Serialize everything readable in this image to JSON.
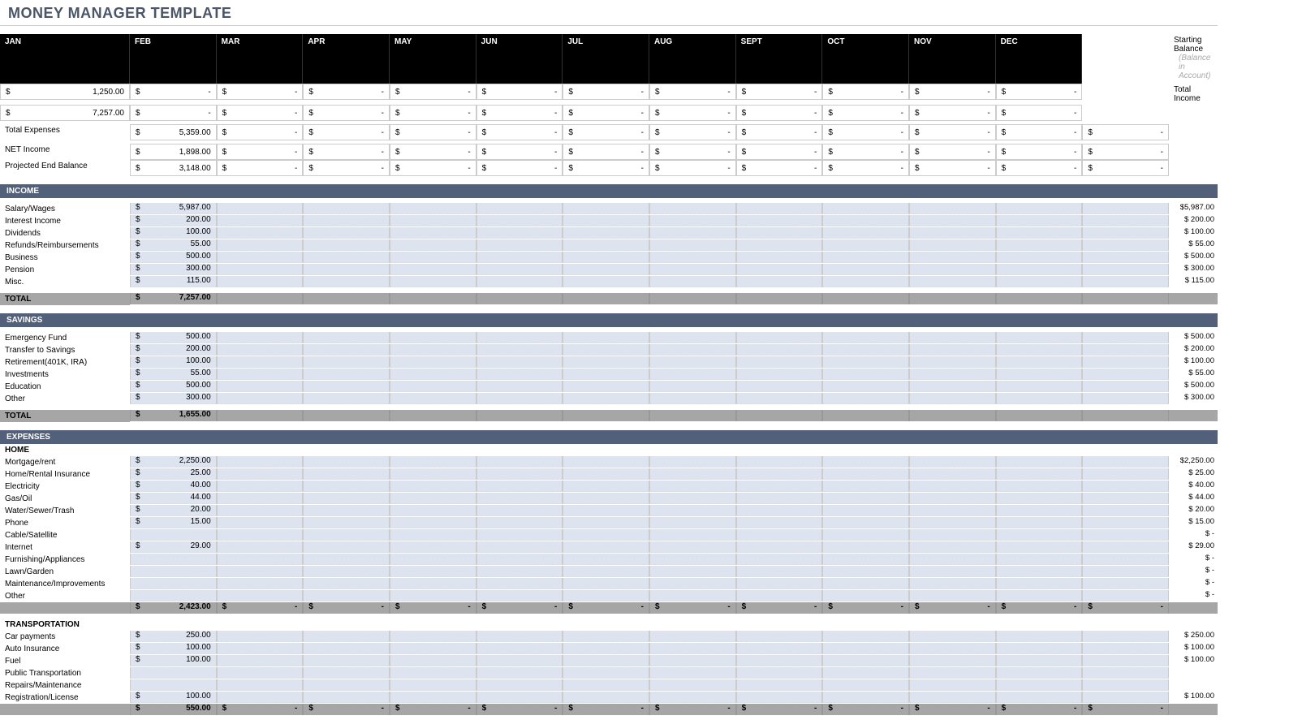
{
  "title": "MONEY MANAGER TEMPLATE",
  "months": [
    "JAN",
    "FEB",
    "MAR",
    "APR",
    "MAY",
    "JUN",
    "JUL",
    "AUG",
    "SEPT",
    "OCT",
    "NOV",
    "DEC"
  ],
  "summary": [
    {
      "label": "Starting Balance",
      "sublabel": "(Balance in Account)",
      "values": [
        "1,250.00",
        "-",
        "-",
        "-",
        "-",
        "-",
        "-",
        "-",
        "-",
        "-",
        "-",
        "-"
      ]
    },
    {
      "label": "Total Income",
      "values": [
        "7,257.00",
        "-",
        "-",
        "-",
        "-",
        "-",
        "-",
        "-",
        "-",
        "-",
        "-",
        "-"
      ]
    },
    {
      "label": "Total Expenses",
      "values": [
        "5,359.00",
        "-",
        "-",
        "-",
        "-",
        "-",
        "-",
        "-",
        "-",
        "-",
        "-",
        "-"
      ]
    },
    {
      "label": "NET Income",
      "values": [
        "1,898.00",
        "-",
        "-",
        "-",
        "-",
        "-",
        "-",
        "-",
        "-",
        "-",
        "-",
        "-"
      ]
    },
    {
      "label": "Projected End Balance",
      "values": [
        "3,148.00",
        "-",
        "-",
        "-",
        "-",
        "-",
        "-",
        "-",
        "-",
        "-",
        "-",
        "-"
      ]
    }
  ],
  "sections": [
    {
      "name": "INCOME",
      "rows": [
        {
          "label": "Salary/Wages",
          "jan": "5,987.00",
          "total": "$5,987.00"
        },
        {
          "label": "Interest Income",
          "jan": "200.00",
          "total": "$  200.00"
        },
        {
          "label": "Dividends",
          "jan": "100.00",
          "total": "$  100.00"
        },
        {
          "label": "Refunds/Reimbursements",
          "jan": "55.00",
          "total": "$    55.00"
        },
        {
          "label": "Business",
          "jan": "500.00",
          "total": "$  500.00"
        },
        {
          "label": "Pension",
          "jan": "300.00",
          "total": "$  300.00"
        },
        {
          "label": "Misc.",
          "jan": "115.00",
          "total": "$  115.00"
        }
      ],
      "total_label": "TOTAL",
      "total_jan": "7,257.00"
    },
    {
      "name": "SAVINGS",
      "rows": [
        {
          "label": "Emergency Fund",
          "jan": "500.00",
          "total": "$  500.00"
        },
        {
          "label": "Transfer to Savings",
          "jan": "200.00",
          "total": "$  200.00"
        },
        {
          "label": "Retirement(401K, IRA)",
          "jan": "100.00",
          "total": "$  100.00"
        },
        {
          "label": "Investments",
          "jan": "55.00",
          "total": "$    55.00"
        },
        {
          "label": "Education",
          "jan": "500.00",
          "total": "$  500.00"
        },
        {
          "label": "Other",
          "jan": "300.00",
          "total": "$  300.00"
        }
      ],
      "total_label": "TOTAL",
      "total_jan": "1,655.00"
    },
    {
      "name": "EXPENSES",
      "subs": [
        {
          "sub": "HOME",
          "rows": [
            {
              "label": "Mortgage/rent",
              "jan": "2,250.00",
              "total": "$2,250.00"
            },
            {
              "label": "Home/Rental Insurance",
              "jan": "25.00",
              "total": "$    25.00"
            },
            {
              "label": "Electricity",
              "jan": "40.00",
              "total": "$    40.00"
            },
            {
              "label": "Gas/Oil",
              "jan": "44.00",
              "total": "$    44.00"
            },
            {
              "label": "Water/Sewer/Trash",
              "jan": "20.00",
              "total": "$    20.00"
            },
            {
              "label": "Phone",
              "jan": "15.00",
              "total": "$    15.00"
            },
            {
              "label": "Cable/Satellite",
              "jan": "",
              "total": "$       -"
            },
            {
              "label": "Internet",
              "jan": "29.00",
              "total": "$    29.00"
            },
            {
              "label": "Furnishing/Appliances",
              "jan": "",
              "total": "$       -"
            },
            {
              "label": "Lawn/Garden",
              "jan": "",
              "total": "$       -"
            },
            {
              "label": "Maintenance/Improvements",
              "jan": "",
              "total": "$       -"
            },
            {
              "label": "Other",
              "jan": "",
              "total": "$       -"
            }
          ],
          "subtotal_jan": "2,423.00",
          "subtotal_rest": true
        },
        {
          "sub": "TRANSPORTATION",
          "rows": [
            {
              "label": "Car payments",
              "jan": "250.00",
              "total": "$  250.00"
            },
            {
              "label": "Auto Insurance",
              "jan": "100.00",
              "total": "$  100.00"
            },
            {
              "label": "Fuel",
              "jan": "100.00",
              "total": "$  100.00"
            },
            {
              "label": "Public Transportation",
              "jan": "",
              "total": ""
            },
            {
              "label": "Repairs/Maintenance",
              "jan": "",
              "total": ""
            },
            {
              "label": "Registration/License",
              "jan": "100.00",
              "total": "$  100.00"
            }
          ],
          "subtotal_jan": "550.00",
          "subtotal_rest": true
        }
      ]
    }
  ],
  "cur": "$"
}
